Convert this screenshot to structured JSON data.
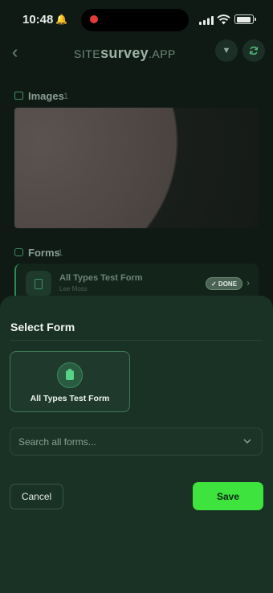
{
  "status_bar": {
    "time": "10:48",
    "icons": [
      "bell-icon",
      "recording-dot",
      "signal-icon",
      "wifi-icon",
      "battery-icon"
    ]
  },
  "header": {
    "logo_prefix": "SITE",
    "logo_main": "survey",
    "logo_suffix": ".APP",
    "icons": [
      "back-chevron-icon",
      "filter-icon",
      "sync-icon"
    ]
  },
  "images_section": {
    "title": "Images",
    "count": "1"
  },
  "forms_section": {
    "title": "Forms",
    "count": "1",
    "items": [
      {
        "title": "All Types Test Form",
        "subtitle": "Lee Moss",
        "status": "✓ DONE"
      }
    ]
  },
  "sheet": {
    "title": "Select Form",
    "form_option": "All Types Test Form",
    "search_placeholder": "Search all forms...",
    "cancel_label": "Cancel",
    "save_label": "Save"
  },
  "colors": {
    "accent": "#3ee33e",
    "sheet_bg": "#1a3126",
    "page_bg": "#0f1a15"
  }
}
